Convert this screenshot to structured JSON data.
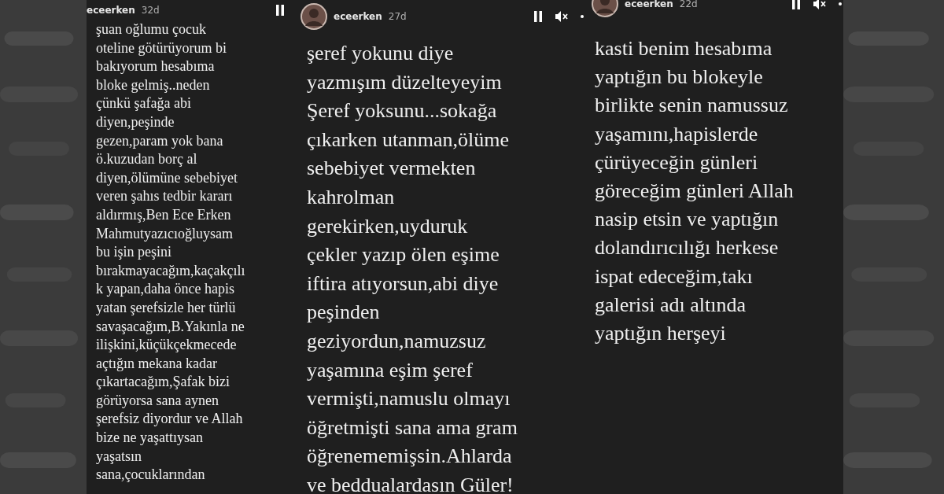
{
  "stories": [
    {
      "username": "eceerken",
      "age": "32d",
      "avatar": false,
      "lines": [
        "şuan oğlumu çocuk",
        "oteline götürüyorum bi",
        "bakıyorum hesabıma",
        "bloke gelmiş..neden",
        "çünkü şafağa abi",
        "diyen,peşinde",
        "gezen,param yok bana",
        "ö.kuzudan borç al",
        "diyen,ölümüne sebebiyet",
        "veren şahıs tedbir kararı",
        "aldırmış,Ben Ece Erken",
        "Mahmutyazıcıoğluysam",
        "bu işin peşini",
        "bırakmayacağım,kaçakçılı",
        "k yapan,daha önce hapis",
        "yatan şerefsizle her türlü",
        "savaşacağım,B.Yakınla ne",
        "ilişkini,küçükçekmecede",
        "açtığın mekana kadar",
        "çıkartacağım,Şafak bizi",
        "görüyorsa sana aynen",
        "şerefsiz diyordur ve Allah",
        "bize ne yaşattıysan",
        "yaşatsın",
        "sana,çocuklarından"
      ]
    },
    {
      "username": "eceerken",
      "age": "27d",
      "avatar": true,
      "lines": [
        "şeref yokunu diye",
        "yazmışım düzelteyeyim",
        "Şeref yoksunu...sokağa",
        "çıkarken utanman,ölüme",
        "sebebiyet vermekten",
        "kahrolman",
        "gerekirken,uyduruk",
        "çekler yazıp ölen eşime",
        "iftira atıyorsun,abi diye",
        "peşinden",
        "geziyordun,namuzsuz",
        "yaşamına eşim şeref",
        "vermişti,namuslu olmayı",
        "öğretmişti sana ama gram",
        "öğrenememişsin.Ahlarda",
        "ve beddualardasın Güler!"
      ]
    },
    {
      "username": "eceerken",
      "age": "22d",
      "avatar": true,
      "lines": [
        "kasti benim hesabıma",
        "yaptığın bu blokeyle",
        "birlikte senin namussuz",
        "yaşamını,hapislerde",
        "çürüyeceğin günleri",
        "göreceğim günleri Allah",
        "nasip etsin ve yaptığın",
        "dolandırıcılığı herkese",
        "ispat edeceğim,takı",
        "galerisi adı altında",
        "yaptığın herşeyi"
      ]
    }
  ]
}
